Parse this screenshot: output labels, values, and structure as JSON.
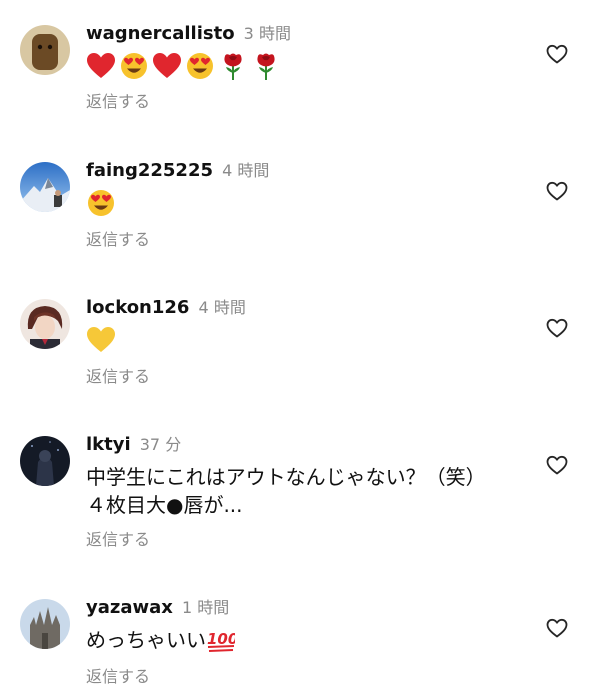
{
  "comments": [
    {
      "username": "wagnercallisto",
      "time": "3 時間",
      "text": "",
      "emojis": [
        "red-heart",
        "heart-eyes",
        "red-heart",
        "heart-eyes",
        "rose",
        "rose"
      ],
      "reply_label": "返信する"
    },
    {
      "username": "faing225225",
      "time": "4 時間",
      "text": "",
      "emojis": [
        "heart-eyes"
      ],
      "reply_label": "返信する"
    },
    {
      "username": "lockon126",
      "time": "4 時間",
      "text": "",
      "emojis": [
        "yellow-heart"
      ],
      "reply_label": "返信する"
    },
    {
      "username": "lktyi",
      "time": "37 分",
      "text_line1": "中学生にこれはアウトなんじゃない？（笑）",
      "text_line2": "４枚目大●唇が...",
      "reply_label": "返信する"
    },
    {
      "username": "yazawax",
      "time": "1 時間",
      "text": "めっちゃいい",
      "emojis": [
        "hundred-points"
      ],
      "reply_label": "返信する"
    }
  ],
  "colors": {
    "username": "#111111",
    "secondary": "#8a8a8a",
    "heart_outline": "#262626"
  }
}
